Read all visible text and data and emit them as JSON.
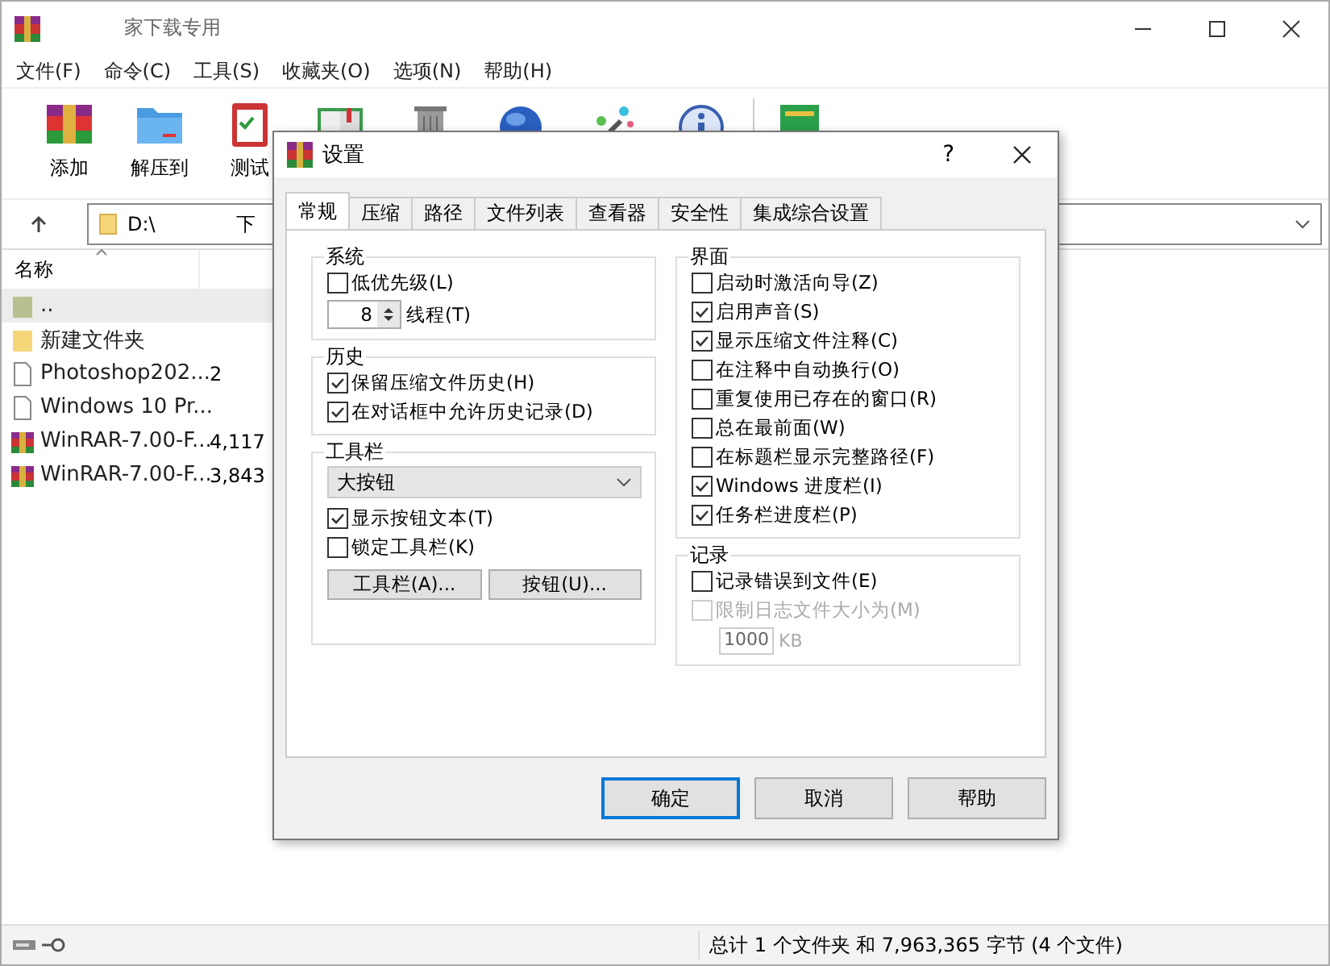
{
  "window": {
    "title": "家下载专用"
  },
  "menu": [
    "文件(F)",
    "命令(C)",
    "工具(S)",
    "收藏夹(O)",
    "选项(N)",
    "帮助(H)"
  ],
  "toolbar": [
    {
      "kind": "archive",
      "label": "添加"
    },
    {
      "kind": "folder",
      "label": "解压到"
    },
    {
      "kind": "clipboard",
      "label": "测试"
    },
    {
      "kind": "book"
    },
    {
      "kind": "trash"
    },
    {
      "kind": "globe"
    },
    {
      "kind": "wand"
    },
    {
      "kind": "info"
    },
    {
      "kind": "green"
    }
  ],
  "address": {
    "drive": "D:\\",
    "tail": "下"
  },
  "list": {
    "columns": [
      "名称"
    ],
    "rows": [
      {
        "kind": "parent",
        "name": "..",
        "size": "",
        "selected": true
      },
      {
        "kind": "folder",
        "name": "新建文件夹",
        "size": "",
        "selected": false
      },
      {
        "kind": "file",
        "name": "Photoshop202...",
        "size": "2",
        "selected": false
      },
      {
        "kind": "file",
        "name": "Windows 10 Pr...",
        "size": "",
        "selected": false
      },
      {
        "kind": "rar",
        "name": "WinRAR-7.00-F...",
        "size": "4,117",
        "selected": false
      },
      {
        "kind": "rar",
        "name": "WinRAR-7.00-F...",
        "size": "3,843",
        "selected": false
      }
    ]
  },
  "status_bar": {
    "text": "总计 1 个文件夹 和 7,963,365 字节 (4 个文件)"
  },
  "dialog": {
    "title": "设置",
    "help": "?",
    "tabs": [
      {
        "label": "常规",
        "selected": true
      },
      {
        "label": "压缩",
        "selected": false
      },
      {
        "label": "路径",
        "selected": false
      },
      {
        "label": "文件列表",
        "selected": false
      },
      {
        "label": "查看器",
        "selected": false
      },
      {
        "label": "安全性",
        "selected": false
      },
      {
        "label": "集成综合设置",
        "selected": false
      }
    ],
    "system": {
      "title": "系统",
      "low_priority": {
        "label": "低优先级(L)",
        "checked": false
      },
      "threads": {
        "value": "8",
        "label": "线程(T)"
      }
    },
    "history": {
      "title": "历史",
      "items": [
        {
          "label": "保留压缩文件历史(H)",
          "checked": true
        },
        {
          "label": "在对话框中允许历史记录(D)",
          "checked": true
        }
      ]
    },
    "toolbar_group": {
      "title": "工具栏",
      "dropdown": "大按钮",
      "items": [
        {
          "label": "显示按钮文本(T)",
          "checked": true
        },
        {
          "label": "锁定工具栏(K)",
          "checked": false
        }
      ],
      "buttons": [
        "工具栏(A)...",
        "按钮(U)..."
      ]
    },
    "interface": {
      "title": "界面",
      "items": [
        {
          "label": "启动时激活向导(Z)",
          "checked": false
        },
        {
          "label": "启用声音(S)",
          "checked": true
        },
        {
          "label": "显示压缩文件注释(C)",
          "checked": true
        },
        {
          "label": "在注释中自动换行(O)",
          "checked": false
        },
        {
          "label": "重复使用已存在的窗口(R)",
          "checked": false
        },
        {
          "label": "总在最前面(W)",
          "checked": false
        },
        {
          "label": "在标题栏显示完整路径(F)",
          "checked": false
        },
        {
          "label": "Windows 进度栏(I)",
          "checked": true
        },
        {
          "label": "任务栏进度栏(P)",
          "checked": true
        }
      ]
    },
    "log": {
      "title": "记录",
      "items": [
        {
          "label": "记录错误到文件(E)",
          "checked": false,
          "disabled": false
        },
        {
          "label": "限制日志文件大小为(M)",
          "checked": false,
          "disabled": true
        }
      ],
      "size_field": {
        "value": "1000",
        "unit": "KB",
        "disabled": true
      }
    },
    "buttons": [
      {
        "label": "确定",
        "selected": true
      },
      {
        "label": "取消",
        "selected": false
      },
      {
        "label": "帮助",
        "selected": false
      }
    ]
  }
}
